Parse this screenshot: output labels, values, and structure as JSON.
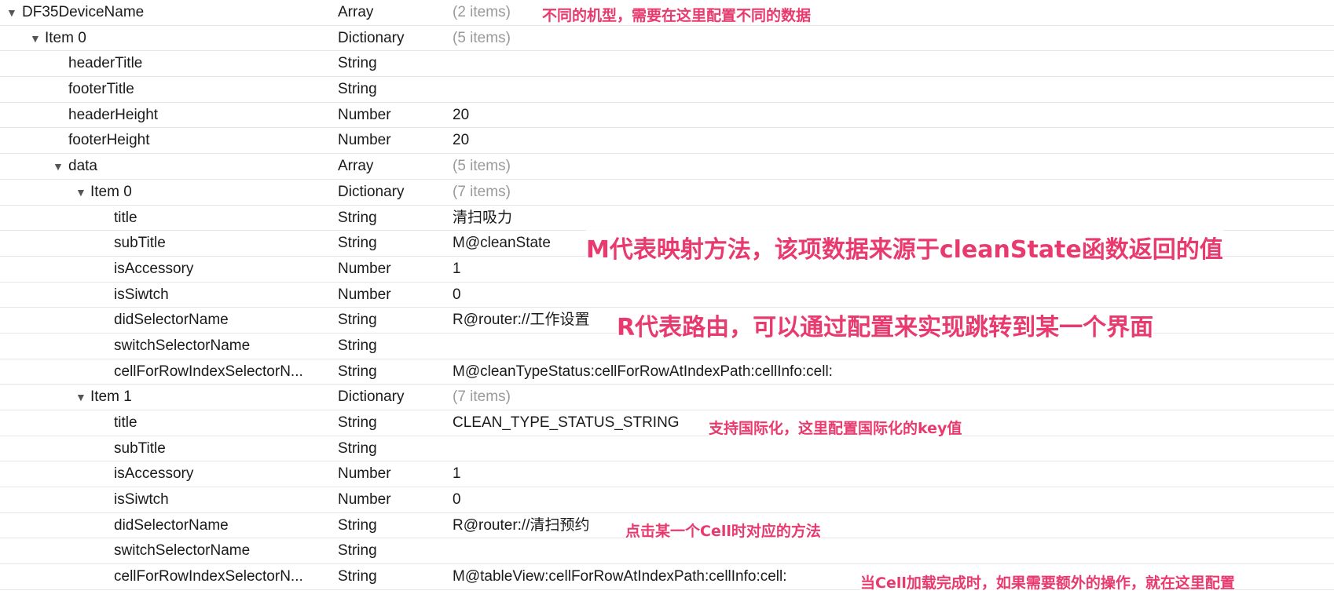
{
  "colors": {
    "annotation": "#e83a6e",
    "row_border": "#e6e6e6",
    "muted_value": "#9a9a9a"
  },
  "rows": [
    {
      "key": "DF35DeviceName",
      "type": "Array",
      "value": "(2 items)",
      "expandable": true,
      "expanded": true,
      "muted": true
    },
    {
      "key": "Item 0",
      "type": "Dictionary",
      "value": "(5 items)",
      "expandable": true,
      "expanded": true,
      "muted": true
    },
    {
      "key": "headerTitle",
      "type": "String",
      "value": "",
      "expandable": false,
      "muted": false
    },
    {
      "key": "footerTitle",
      "type": "String",
      "value": "",
      "expandable": false,
      "muted": false
    },
    {
      "key": "headerHeight",
      "type": "Number",
      "value": "20",
      "expandable": false,
      "muted": false
    },
    {
      "key": "footerHeight",
      "type": "Number",
      "value": "20",
      "expandable": false,
      "muted": false
    },
    {
      "key": "data",
      "type": "Array",
      "value": "(5 items)",
      "expandable": true,
      "expanded": true,
      "muted": true
    },
    {
      "key": "Item 0",
      "type": "Dictionary",
      "value": "(7 items)",
      "expandable": true,
      "expanded": true,
      "muted": true
    },
    {
      "key": "title",
      "type": "String",
      "value": "清扫吸力",
      "expandable": false,
      "muted": false
    },
    {
      "key": "subTitle",
      "type": "String",
      "value": "M@cleanState",
      "expandable": false,
      "muted": false
    },
    {
      "key": "isAccessory",
      "type": "Number",
      "value": "1",
      "expandable": false,
      "muted": false
    },
    {
      "key": "isSiwtch",
      "type": "Number",
      "value": "0",
      "expandable": false,
      "muted": false
    },
    {
      "key": "didSelectorName",
      "type": "String",
      "value": "R@router://工作设置",
      "expandable": false,
      "muted": false
    },
    {
      "key": "switchSelectorName",
      "type": "String",
      "value": "",
      "expandable": false,
      "muted": false
    },
    {
      "key": "cellForRowIndexSelectorN...",
      "type": "String",
      "value": "M@cleanTypeStatus:cellForRowAtIndexPath:cellInfo:cell:",
      "expandable": false,
      "muted": false
    },
    {
      "key": "Item 1",
      "type": "Dictionary",
      "value": "(7 items)",
      "expandable": true,
      "expanded": true,
      "muted": true
    },
    {
      "key": "title",
      "type": "String",
      "value": "CLEAN_TYPE_STATUS_STRING",
      "expandable": false,
      "muted": false
    },
    {
      "key": "subTitle",
      "type": "String",
      "value": "",
      "expandable": false,
      "muted": false
    },
    {
      "key": "isAccessory",
      "type": "Number",
      "value": "1",
      "expandable": false,
      "muted": false
    },
    {
      "key": "isSiwtch",
      "type": "Number",
      "value": "0",
      "expandable": false,
      "muted": false
    },
    {
      "key": "didSelectorName",
      "type": "String",
      "value": "R@router://清扫预约",
      "expandable": false,
      "muted": false
    },
    {
      "key": "switchSelectorName",
      "type": "String",
      "value": "",
      "expandable": false,
      "muted": false
    },
    {
      "key": "cellForRowIndexSelectorN...",
      "type": "String",
      "value": "M@tableView:cellForRowAtIndexPath:cellInfo:cell:",
      "expandable": false,
      "muted": false
    }
  ],
  "annotations": {
    "device_models": "不同的机型，需要在这里配置不同的数据",
    "mapping_method": "M代表映射方法，该项数据来源于cleanState函数返回的值",
    "routing": "R代表路由，可以通过配置来实现跳转到某一个界面",
    "i18n": "支持国际化，这里配置国际化的key值",
    "cell_click": "点击某一个Cell时对应的方法",
    "cell_loaded": "当Cell加载完成时，如果需要额外的操作，就在这里配置"
  }
}
